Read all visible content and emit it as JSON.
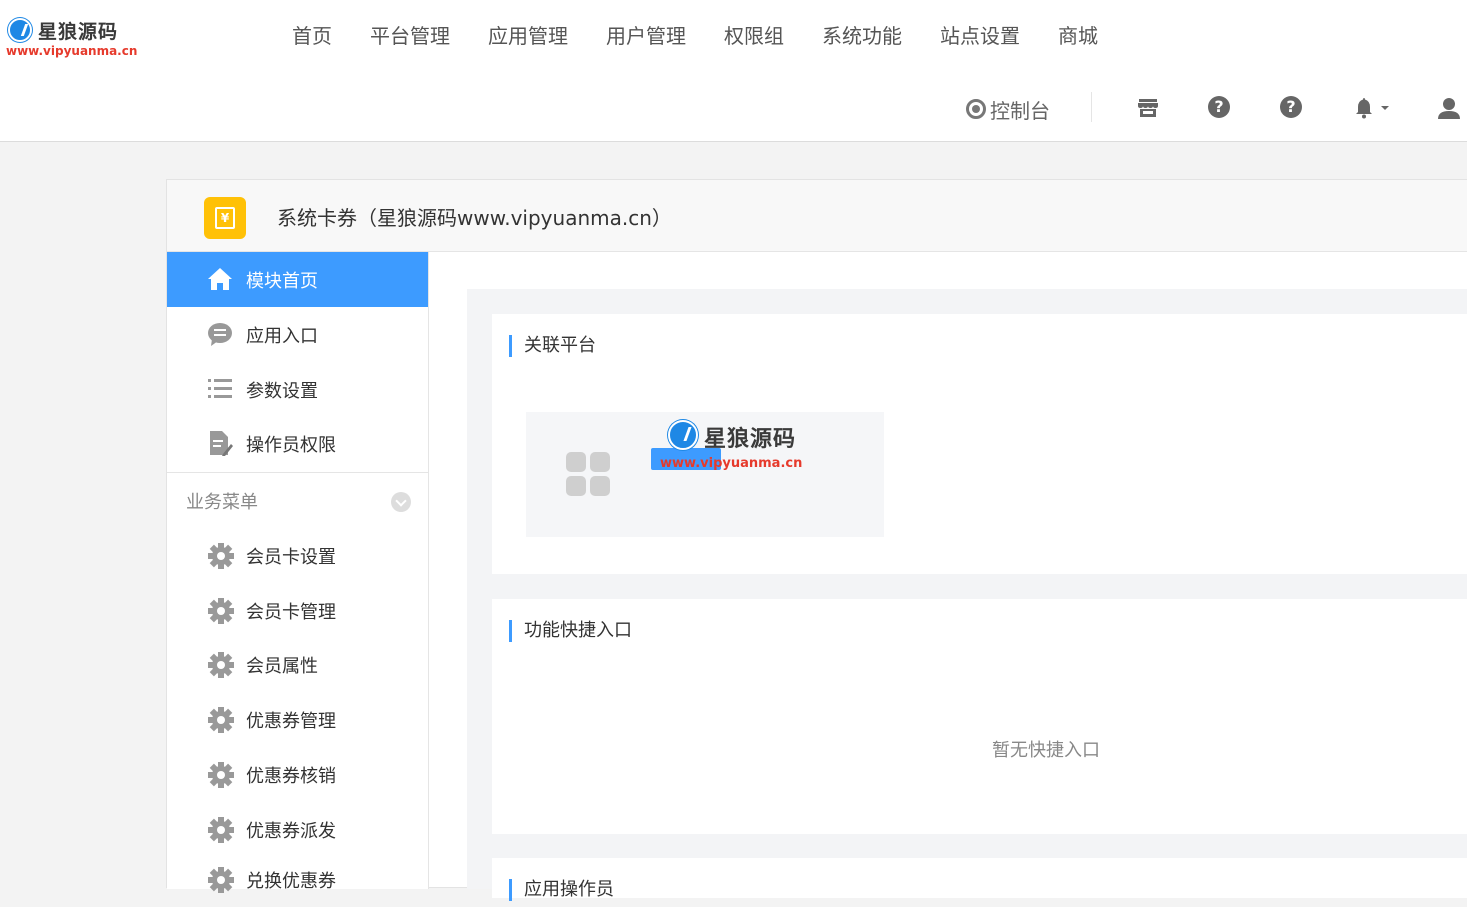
{
  "brand": {
    "logo_name": "星狼源码",
    "logo_url": "www.vipyuanma.cn",
    "colors": {
      "accent": "#3d9bff",
      "logo_blue": "#1e88e5",
      "logo_red": "#e63a2c",
      "module_icon": "#ffc107"
    }
  },
  "topnav": {
    "items": [
      {
        "label": "首页"
      },
      {
        "label": "平台管理"
      },
      {
        "label": "应用管理"
      },
      {
        "label": "用户管理"
      },
      {
        "label": "权限组"
      },
      {
        "label": "系统功能"
      },
      {
        "label": "站点设置"
      },
      {
        "label": "商城"
      }
    ]
  },
  "toolbar": {
    "console_label": "控制台",
    "icons": [
      "target-icon",
      "store-icon",
      "help-icon",
      "help-icon",
      "bell-icon",
      "chevron-down-icon",
      "user-icon"
    ]
  },
  "module": {
    "icon": "coupon-icon",
    "coupon_symbol": "¥",
    "title": "系统卡券（星狼源码www.vipyuanma.cn）"
  },
  "sidemenu": {
    "top_items": [
      {
        "label": "模块首页",
        "icon": "home-icon",
        "active": true
      },
      {
        "label": "应用入口",
        "icon": "chat-icon",
        "active": false
      },
      {
        "label": "参数设置",
        "icon": "list-icon",
        "active": false
      },
      {
        "label": "操作员权限",
        "icon": "document-edit-icon",
        "active": false
      }
    ],
    "group": {
      "label": "业务菜单",
      "items": [
        {
          "label": "会员卡设置",
          "icon": "gear-icon"
        },
        {
          "label": "会员卡管理",
          "icon": "gear-icon"
        },
        {
          "label": "会员属性",
          "icon": "gear-icon"
        },
        {
          "label": "优惠券管理",
          "icon": "gear-icon"
        },
        {
          "label": "优惠券核销",
          "icon": "gear-icon"
        },
        {
          "label": "优惠券派发",
          "icon": "gear-icon"
        },
        {
          "label": "兑换优惠券",
          "icon": "gear-icon"
        }
      ]
    }
  },
  "main": {
    "linked_platform": {
      "title": "关联平台",
      "platform_icon": "grid-icon",
      "watermark_name": "星狼源码",
      "watermark_url": "www.vipyuanma.cn"
    },
    "shortcuts": {
      "title": "功能快捷入口",
      "empty_text": "暂无快捷入口"
    },
    "operators": {
      "title": "应用操作员"
    }
  }
}
